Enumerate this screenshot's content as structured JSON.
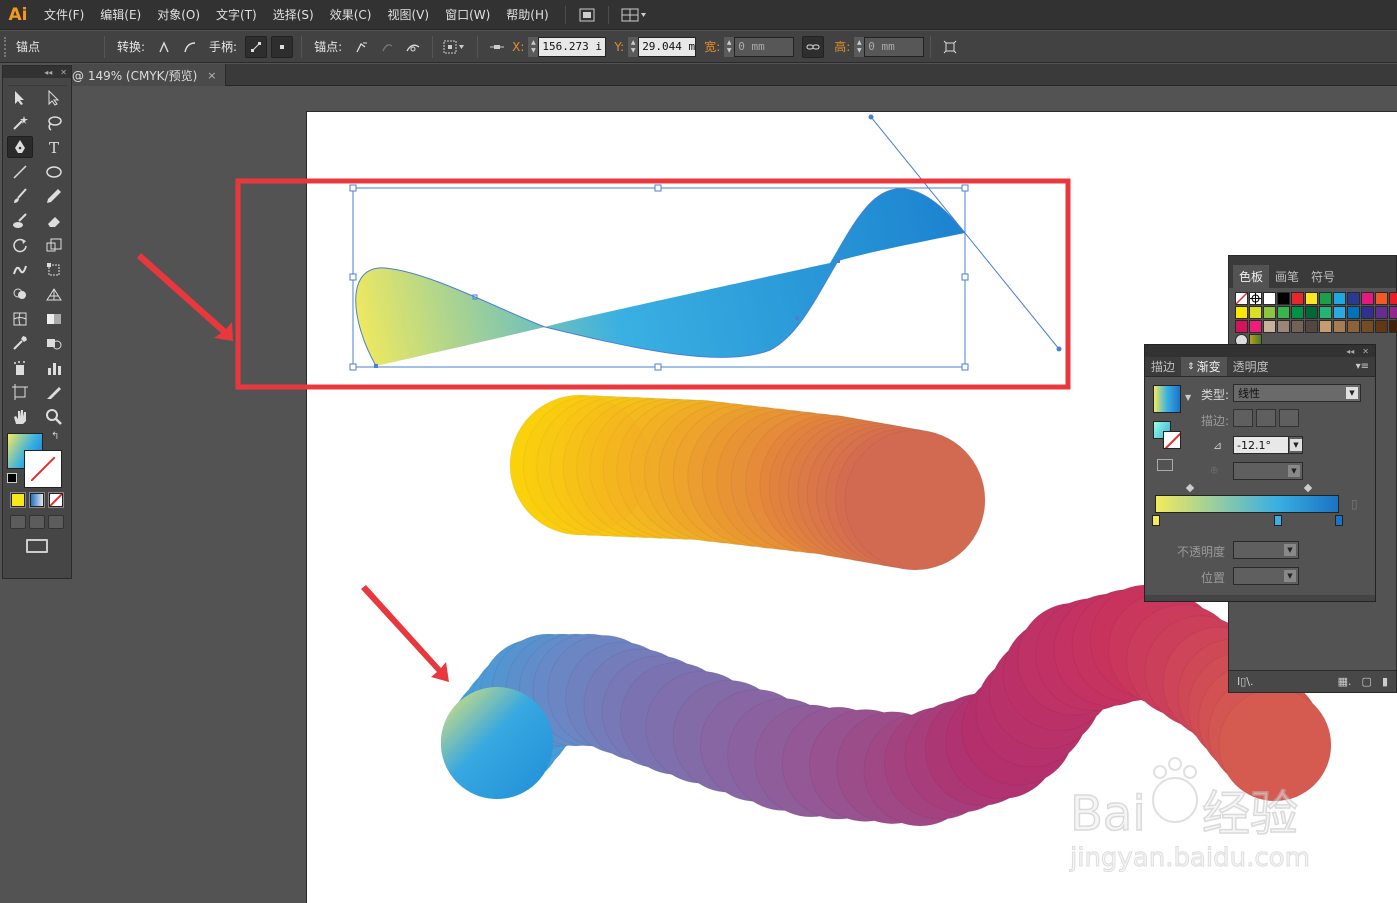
{
  "app": {
    "logo": "Ai"
  },
  "menu": [
    "文件(F)",
    "编辑(E)",
    "对象(O)",
    "文字(T)",
    "选择(S)",
    "效果(C)",
    "视图(V)",
    "窗口(W)",
    "帮助(H)"
  ],
  "control_bar": {
    "anchor_label": "锚点",
    "convert_label": "转换:",
    "handles_label": "手柄:",
    "anchor_points_label": "锚点:",
    "x_label": "X:",
    "x_value": "156.273 i",
    "y_label": "Y:",
    "y_value": "29.044 mi",
    "w_label": "宽:",
    "w_value": "0 mm",
    "h_label": "高:",
    "h_value": "0 mm"
  },
  "document_tab": {
    "title": "@ 149% (CMYK/预览)",
    "close": "×"
  },
  "swatches_panel": {
    "tabs": [
      "色板",
      "画笔",
      "符号"
    ],
    "colors": [
      "#ffffff",
      "#ffffff",
      "#ffffff",
      "#000000",
      "#e8262b",
      "#f7e620",
      "#1aa04a",
      "#1fa7df",
      "#2b3990",
      "#e6177f",
      "#f15a24",
      "#ed1c24",
      "#fbe700",
      "#d9e021",
      "#8cc63f",
      "#39b54a",
      "#009245",
      "#006837",
      "#22b573",
      "#29abe2",
      "#0071bc",
      "#2e3192",
      "#662d91",
      "#93278f",
      "#d4145a",
      "#ed1e79",
      "#c7b299",
      "#998675",
      "#736357",
      "#534741",
      "#c69c6d",
      "#a67c52",
      "#8c6239",
      "#754c24",
      "#603813",
      "#42210b"
    ]
  },
  "gradient_panel": {
    "tabs": [
      "描边",
      "渐变",
      "透明度"
    ],
    "type_label": "类型:",
    "type_value": "线性",
    "stroke_label": "描边:",
    "angle_value": "-12.1°",
    "opacity_label": "不透明度",
    "location_label": "位置",
    "gradient_colors": [
      "#f3ea5c",
      "#3ab0e2",
      "#1b73c4"
    ]
  },
  "watermark": {
    "text": "Bai du 经验",
    "sub": "jingyan.baidu.com"
  },
  "icons": [
    "selection-icon",
    "direct-selection-icon",
    "magic-wand-icon",
    "lasso-icon",
    "pen-icon",
    "type-icon",
    "line-icon",
    "ellipse-icon",
    "paintbrush-icon",
    "pencil-icon",
    "blob-brush-icon",
    "eraser-icon",
    "rotate-icon",
    "scale-icon",
    "warp-icon",
    "free-transform-icon",
    "shape-builder-icon",
    "perspective-grid-icon",
    "mesh-icon",
    "gradient-icon",
    "eyedropper-icon",
    "blend-icon",
    "symbol-sprayer-icon",
    "column-graph-icon",
    "artboard-icon",
    "slice-icon",
    "hand-icon",
    "zoom-icon"
  ],
  "colors": {
    "highlight": "#e8383d",
    "arrow": "#e8383d",
    "accent": "#f39a1e"
  }
}
